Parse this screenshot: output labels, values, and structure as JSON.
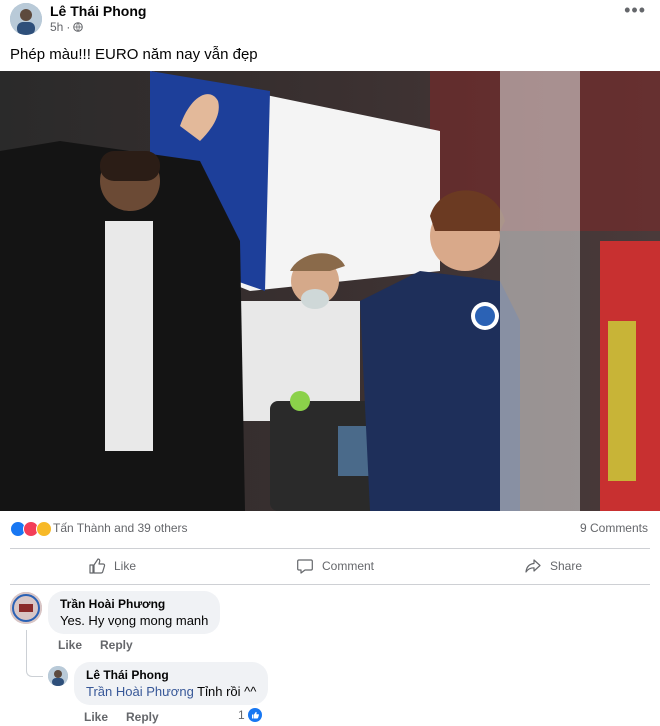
{
  "post": {
    "author": "Lê Thái Phong",
    "time": "5h",
    "separator": "·",
    "more": "•••",
    "text": "Phép màu!!! EURO năm nay vẫn đẹp"
  },
  "reactions": {
    "summary": "Tấn Thành and 39 others",
    "comments": "9 Comments"
  },
  "actions": {
    "like": "Like",
    "comment": "Comment",
    "share": "Share"
  },
  "comments": [
    {
      "author": "Trần Hoài Phương",
      "text": "Yes. Hy vọng mong manh",
      "like": "Like",
      "reply": "Reply"
    },
    {
      "author": "Lê Thái Phong",
      "mention": "Trần Hoài Phương",
      "text": " Tỉnh rồi ^^",
      "like": "Like",
      "reply": "Reply",
      "like_count": "1"
    }
  ],
  "colors": {
    "like_blue": "#1877f2",
    "love_red": "#f33e58",
    "haha_yellow": "#f7b928",
    "mention": "#385898",
    "secondary_text": "#65676b"
  }
}
